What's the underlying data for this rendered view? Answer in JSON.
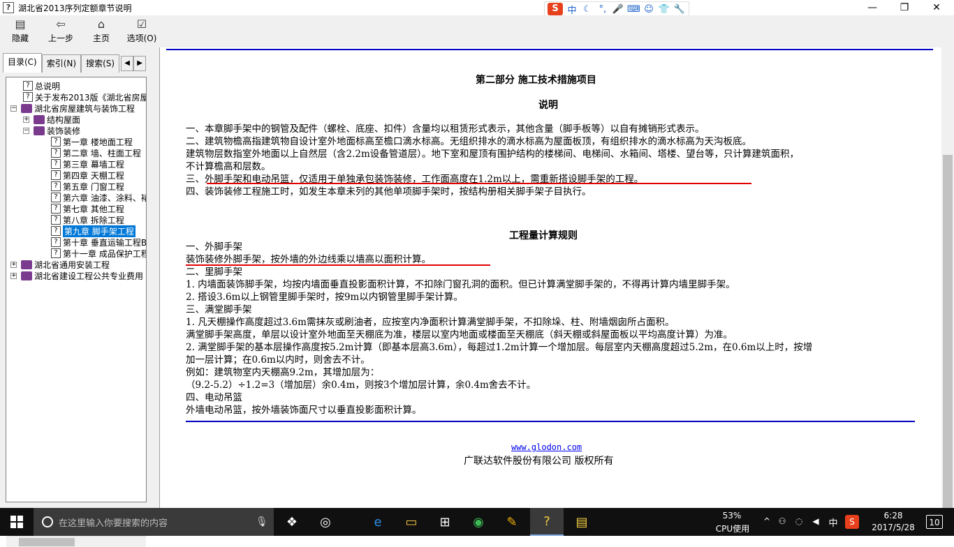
{
  "window": {
    "title": "湖北省2013序列定额章节说明",
    "minimize": "—",
    "restore": "❐",
    "close": "✕"
  },
  "ime": {
    "logo": "S",
    "items": [
      "中",
      "☾",
      "°,",
      "🎤",
      "⌨",
      "☺",
      "👕",
      "🔧"
    ]
  },
  "toolbar": {
    "hide": "隐藏",
    "back": "上一步",
    "home": "主页",
    "options": "选项(O)"
  },
  "tabs": {
    "contents": "目录(C)",
    "index": "索引(N)",
    "search": "搜索(S)",
    "left_arrow": "◀",
    "right_arrow": "▶"
  },
  "tree": [
    {
      "label": "总说明",
      "icon": "q",
      "indent": 1
    },
    {
      "label": "关于发布2013版《湖北省房屋",
      "icon": "q",
      "indent": 1
    },
    {
      "label": "湖北省房屋建筑与装饰工程",
      "icon": "book",
      "indent": 0,
      "exp": "−"
    },
    {
      "label": "结构屋面",
      "icon": "book",
      "indent": 1,
      "exp": "+"
    },
    {
      "label": "装饰装修",
      "icon": "book",
      "indent": 1,
      "exp": "−"
    },
    {
      "label": "第一章  楼地面工程",
      "icon": "q",
      "indent": 2
    },
    {
      "label": "第二章  墙、柱面工程",
      "icon": "q",
      "indent": 2
    },
    {
      "label": "第三章  幕墙工程",
      "icon": "q",
      "indent": 2
    },
    {
      "label": "第四章  天棚工程",
      "icon": "q",
      "indent": 2
    },
    {
      "label": "第五章  门窗工程",
      "icon": "q",
      "indent": 2
    },
    {
      "label": "第六章  油漆、涂料、裱",
      "icon": "q",
      "indent": 2
    },
    {
      "label": "第七章  其他工程",
      "icon": "q",
      "indent": 2
    },
    {
      "label": "第八章  拆除工程",
      "icon": "q",
      "indent": 2
    },
    {
      "label": "第九章  脚手架工程",
      "icon": "q",
      "indent": 2,
      "selected": true
    },
    {
      "label": "第十章  垂直运输工程B",
      "icon": "q",
      "indent": 2
    },
    {
      "label": "第十一章  成品保护工程",
      "icon": "q",
      "indent": 2
    },
    {
      "label": "湖北省通用安装工程",
      "icon": "book",
      "indent": 0,
      "exp": "+"
    },
    {
      "label": "湖北省建设工程公共专业费用",
      "icon": "book",
      "indent": 0,
      "exp": "+"
    }
  ],
  "doc": {
    "part_title": "第二部分  施工技术措施项目",
    "explain_title": "说明",
    "explain_lines": [
      "一、本章脚手架中的钢管及配件（螺栓、底座、扣件）含量均以租赁形式表示，其他含量（脚手板等）以自有摊销形式表示。",
      "二、建筑物檐高指建筑物自设计室外地面标高至檐口滴水标高。无组织排水的滴水标高为屋面板顶，有组织排水的滴水标高为天沟板底。",
      "建筑物层数指室外地面以上自然层（含2.2m设备管道层）。地下室和屋顶有围护结构的楼梯间、电梯间、水箱间、塔楼、望台等，只计算建筑面积，",
      "不计算檐高和层数。",
      "三、外脚手架和电动吊篮，仅适用于单独承包装饰装修，工作面高度在1.2m以上，需重新搭设脚手架的工程。",
      "四、装饰装修工程施工时，如发生本章未列的其他单项脚手架时，按结构册相关脚手架子目执行。"
    ],
    "rules_title": "工程量计算规则",
    "rules_lines": [
      "一、外脚手架",
      "装饰装修外脚手架，按外墙的外边线乘以墙高以面积计算。",
      "二、里脚手架",
      "1. 内墙面装饰脚手架，均按内墙面垂直投影面积计算，不扣除门窗孔洞的面积。但已计算满堂脚手架的，不得再计算内墙里脚手架。",
      "2. 搭设3.6m以上钢管里脚手架时，按9m以内钢管里脚手架计算。",
      "三、满堂脚手架",
      "1. 凡天棚操作高度超过3.6m需抹灰或刷油者，应按室内净面积计算满堂脚手架，不扣除垛、柱、附墙烟囱所占面积。",
      "满堂脚手架高度，单层以设计室外地面至天棚底为准，楼层以室内地面或楼面至天棚底（斜天棚或斜屋面板以平均高度计算）为准。",
      "2. 满堂脚手架的基本层操作高度按5.2m计算（即基本层高3.6m），每超过1.2m计算一个增加层。每层室内天棚高度超过5.2m，在0.6m以上时，按增",
      "加一层计算；在0.6m以内时，则舍去不计。",
      "例如：建筑物室内天棚高9.2m，其增加层为：",
      "（9.2-5.2）÷1.2=3（增加层）余0.4m，则按3个增加层计算，余0.4m舍去不计。",
      "四、电动吊篮",
      "外墙电动吊篮，按外墙装饰面尺寸以垂直投影面积计算。"
    ],
    "footer_link": "www.glodon.com",
    "footer_copy": "广联达软件股份有限公司 版权所有",
    "rule_color": "#0000c0",
    "underline_color": "#e00000"
  },
  "taskbar": {
    "search_placeholder": "在这里输入你要搜索的内容",
    "cpu_percent": "53%",
    "cpu_label": "CPU使用",
    "ime_lang": "中",
    "time": "6:28",
    "date": "2017/5/28",
    "notification_count": "10",
    "apps": [
      "task-view",
      "cortana",
      "edge",
      "file-explorer",
      "store",
      "360-browser",
      "notes",
      "help",
      "document"
    ]
  }
}
